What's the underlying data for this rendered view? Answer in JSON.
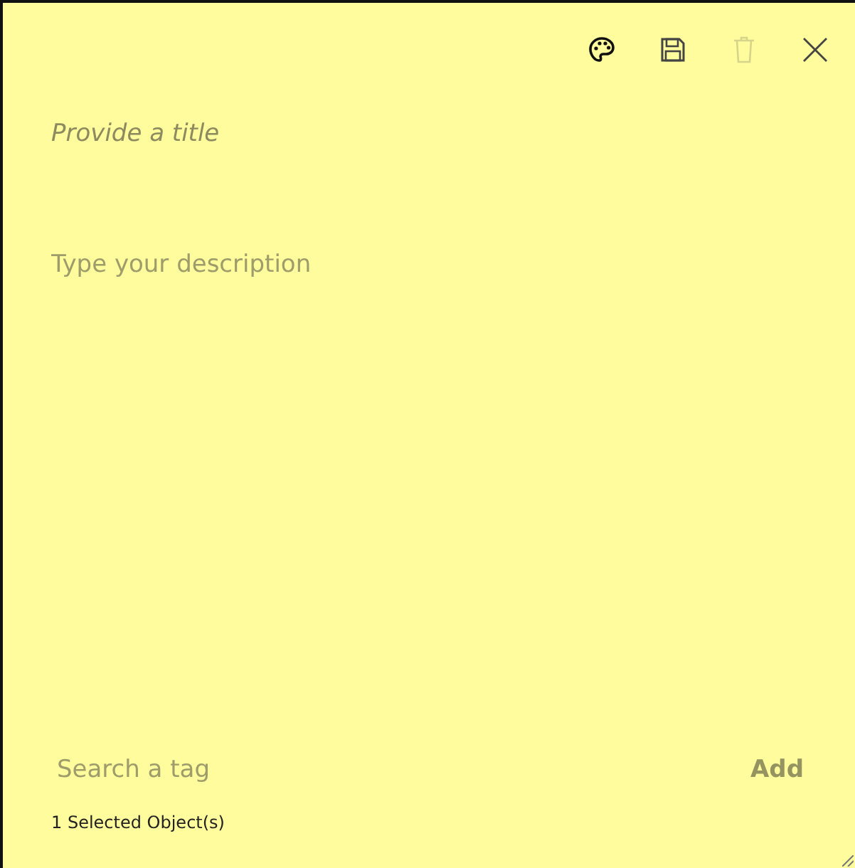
{
  "toolbar": [
    {
      "kind": "palette",
      "disabled": false
    },
    {
      "kind": "save",
      "disabled": false
    },
    {
      "kind": "delete",
      "disabled": true
    },
    {
      "kind": "close",
      "disabled": false
    }
  ],
  "title": {
    "placeholder": "Provide a title"
  },
  "description": {
    "placeholder": "Type your description"
  },
  "tag_search": {
    "placeholder": "Search a tag"
  },
  "add_button": "Add",
  "status": "1 Selected Object(s)"
}
